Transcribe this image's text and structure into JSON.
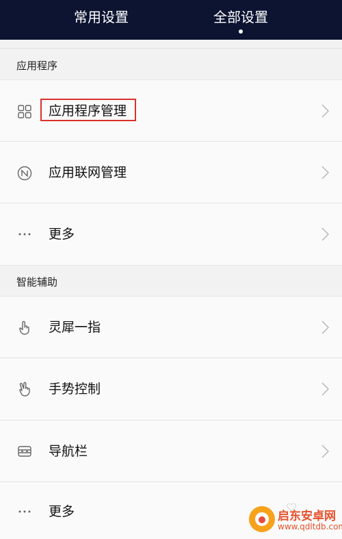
{
  "tabs": [
    {
      "label": "常用设置",
      "active": false
    },
    {
      "label": "全部设置",
      "active": true
    }
  ],
  "sections": [
    {
      "header": "应用程序",
      "items": [
        {
          "label": "应用程序管理",
          "icon": "grid-icon",
          "highlighted": true
        },
        {
          "label": "应用联网管理",
          "icon": "network-icon"
        },
        {
          "label": "更多",
          "icon": "more-dots-icon"
        }
      ]
    },
    {
      "header": "智能辅助",
      "items": [
        {
          "label": "灵犀一指",
          "icon": "finger-tap-icon"
        },
        {
          "label": "手势控制",
          "icon": "hand-gesture-icon"
        },
        {
          "label": "导航栏",
          "icon": "navigation-bar-icon"
        },
        {
          "label": "更多",
          "icon": "more-dots-icon"
        }
      ]
    }
  ],
  "watermark": {
    "title": "启东安卓网",
    "url": "www.qdltdb.com"
  },
  "colors": {
    "topbar": "#0c1431",
    "background": "#f2f2f2",
    "row": "#fafafa",
    "highlight_border": "#d9312b",
    "watermark": "#e8502a"
  }
}
